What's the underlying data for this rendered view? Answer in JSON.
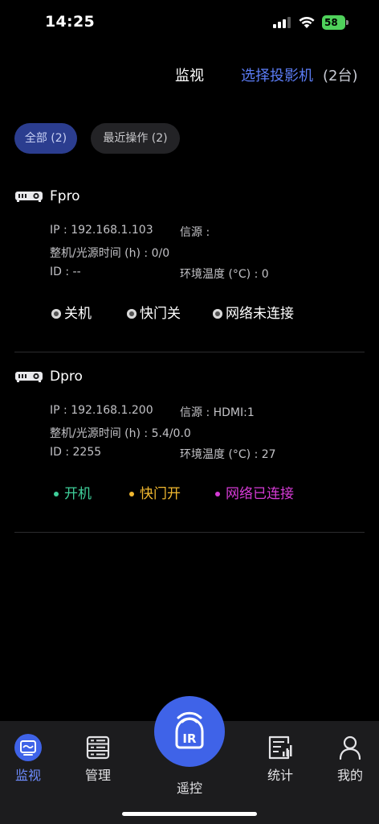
{
  "status_bar": {
    "time": "14:25",
    "battery": "58"
  },
  "header": {
    "monitor_label": "监视",
    "select_label": "选择投影机",
    "count_label": "(2台)"
  },
  "filters": {
    "all": "全部 (2)",
    "recent": "最近操作 (2)"
  },
  "devices": [
    {
      "name": "Fpro",
      "ip": "IP : 192.168.1.103",
      "source": "信源 :",
      "hours": "整机/光源时间 (h) : 0/0",
      "id": "ID : --",
      "temp": "环境温度 (°C) : 0",
      "statuses": [
        {
          "label": "关机",
          "color": "#ffffff"
        },
        {
          "label": "快门关",
          "color": "#ffffff"
        },
        {
          "label": "网络未连接",
          "color": "#ffffff"
        }
      ]
    },
    {
      "name": "Dpro",
      "ip": "IP : 192.168.1.200",
      "source": "信源 : HDMI:1",
      "hours": "整机/光源时间 (h) : 5.4/0.0",
      "id": "ID : 2255",
      "temp": "环境温度 (°C) : 27",
      "statuses": [
        {
          "label": "开机",
          "color": "#3fcf9a"
        },
        {
          "label": "快门开",
          "color": "#f1b830"
        },
        {
          "label": "网络已连接",
          "color": "#d63bd6"
        }
      ]
    }
  ],
  "tabs": {
    "monitor": "监视",
    "manage": "管理",
    "remote": "遥控",
    "stats": "统计",
    "mine": "我的"
  },
  "remote_icon_text": "IR",
  "colors": {
    "accent": "#5b7cf5",
    "tab_active": "#6e8cff",
    "remote": "#3f63e8",
    "battery": "#4fd15b"
  },
  "icons": [
    "projector-icon",
    "monitor-tab-icon",
    "manage-tab-icon",
    "remote-ir-icon",
    "stats-tab-icon",
    "profile-tab-icon"
  ]
}
